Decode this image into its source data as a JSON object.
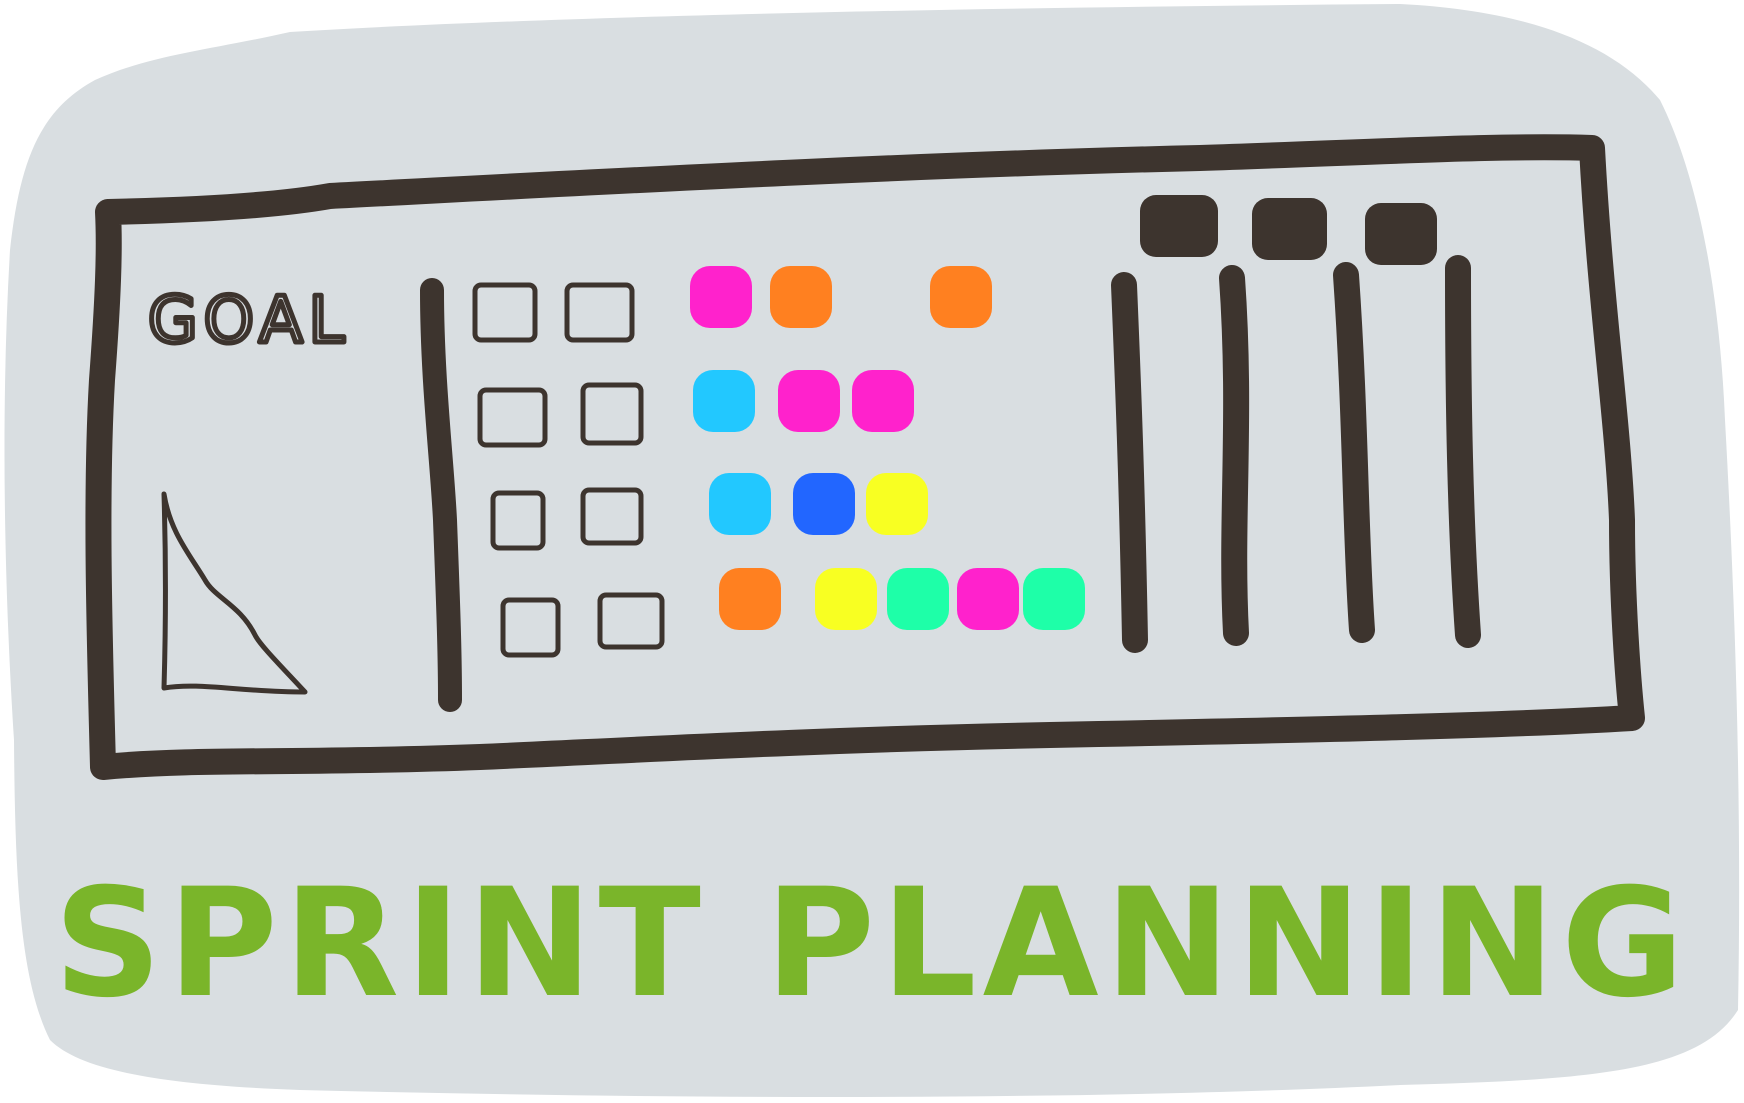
{
  "board": {
    "goal_label": "GOAL"
  },
  "caption": {
    "text": "SPRINT PLANNING"
  },
  "colors": {
    "background_blob": "#d9dee1",
    "ink": "#3d342e",
    "caption": "#7ab52a",
    "sticky_pink": "#ff22cc",
    "sticky_orange": "#ff8020",
    "sticky_cyan": "#22c8ff",
    "sticky_blue": "#2266ff",
    "sticky_yellow": "#f8ff22",
    "sticky_green": "#1effa8"
  },
  "sticky_rows": [
    [
      "pink",
      "orange",
      "orange"
    ],
    [
      "cyan",
      "pink",
      "pink"
    ],
    [
      "cyan",
      "blue",
      "yellow"
    ],
    [
      "orange",
      "yellow",
      "green",
      "pink",
      "green"
    ]
  ]
}
